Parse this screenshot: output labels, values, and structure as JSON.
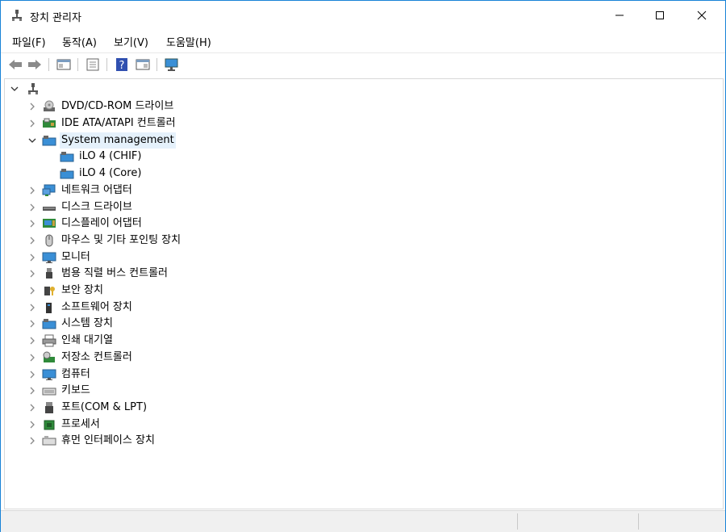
{
  "window": {
    "title": "장치 관리자",
    "title_icon": "device-manager-icon"
  },
  "menu": [
    {
      "label": "파일(F)"
    },
    {
      "label": "동작(A)"
    },
    {
      "label": "보기(V)"
    },
    {
      "label": "도움말(H)"
    }
  ],
  "toolbar": {
    "buttons": [
      "back-icon",
      "forward-icon",
      "show-hide-console-tree-icon",
      "properties-icon",
      "help-icon",
      "action-pane-icon",
      "scan-hardware-icon"
    ]
  },
  "tree": {
    "root_icon": "computer-icon",
    "items": [
      {
        "label": "DVD/CD-ROM 드라이브",
        "icon": "dvd-drive-icon",
        "expanded": false
      },
      {
        "label": "IDE ATA/ATAPI 컨트롤러",
        "icon": "ide-controller-icon",
        "expanded": false
      },
      {
        "label": "System management",
        "icon": "system-management-icon",
        "expanded": true,
        "selected": true,
        "children": [
          {
            "label": "iLO 4 (CHIF)",
            "icon": "ilo-device-icon"
          },
          {
            "label": "iLO 4 (Core)",
            "icon": "ilo-device-icon"
          }
        ]
      },
      {
        "label": "네트워크 어댑터",
        "icon": "network-adapter-icon",
        "expanded": false
      },
      {
        "label": "디스크 드라이브",
        "icon": "disk-drive-icon",
        "expanded": false
      },
      {
        "label": "디스플레이 어댑터",
        "icon": "display-adapter-icon",
        "expanded": false
      },
      {
        "label": "마우스 및 기타 포인팅 장치",
        "icon": "mouse-icon",
        "expanded": false
      },
      {
        "label": "모니터",
        "icon": "monitor-icon",
        "expanded": false
      },
      {
        "label": "범용 직렬 버스 컨트롤러",
        "icon": "usb-icon",
        "expanded": false
      },
      {
        "label": "보안 장치",
        "icon": "security-device-icon",
        "expanded": false
      },
      {
        "label": "소프트웨어 장치",
        "icon": "software-device-icon",
        "expanded": false
      },
      {
        "label": "시스템 장치",
        "icon": "system-device-icon",
        "expanded": false
      },
      {
        "label": "인쇄 대기열",
        "icon": "printer-icon",
        "expanded": false
      },
      {
        "label": "저장소 컨트롤러",
        "icon": "storage-controller-icon",
        "expanded": false
      },
      {
        "label": "컴퓨터",
        "icon": "computer-monitor-icon",
        "expanded": false
      },
      {
        "label": "키보드",
        "icon": "keyboard-icon",
        "expanded": false
      },
      {
        "label": "포트(COM & LPT)",
        "icon": "port-icon",
        "expanded": false
      },
      {
        "label": "프로세서",
        "icon": "processor-icon",
        "expanded": false
      },
      {
        "label": "휴먼 인터페이스 장치",
        "icon": "hid-icon",
        "expanded": false
      }
    ]
  },
  "colors": {
    "selection": "#e5f1fb",
    "border": "#1883d7"
  }
}
